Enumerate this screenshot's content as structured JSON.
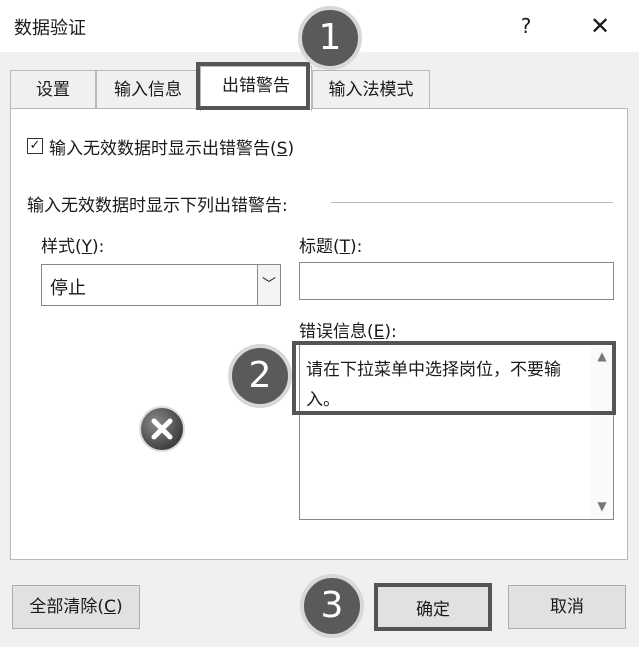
{
  "window": {
    "title": "数据验证",
    "help_label": "?",
    "close_label": "✕"
  },
  "tabs": [
    {
      "label": "设置",
      "active": false
    },
    {
      "label": "输入信息",
      "active": false
    },
    {
      "label": "出错警告",
      "active": true
    },
    {
      "label": "输入法模式",
      "active": false
    }
  ],
  "panel": {
    "show_error_checkbox": {
      "checked": true,
      "check_mark": "☑",
      "label_main": "输入无效数据时显示出错警告(",
      "label_key": "S",
      "label_end": ")"
    },
    "group_label": "输入无效数据时显示下列出错警告:",
    "style": {
      "label_main": "样式(",
      "label_key": "Y",
      "label_end": "):",
      "value": "停止",
      "dropdown_arrow": "﹀"
    },
    "title_field": {
      "label_main": "标题(",
      "label_key": "T",
      "label_end": "):",
      "value": ""
    },
    "error_message": {
      "label_main": "错误信息(",
      "label_key": "E",
      "label_end": "):",
      "value": "请在下拉菜单中选择岗位，不要输入。"
    },
    "stop_icon": "error-stop-icon"
  },
  "callouts": [
    "1",
    "2",
    "3"
  ],
  "buttons": {
    "clear_all_main": "全部清除(",
    "clear_all_key": "C",
    "clear_all_end": ")",
    "ok": "确定",
    "cancel": "取消"
  },
  "colors": {
    "callout_fill": "#5a5a5a",
    "panel_bg": "#ffffff",
    "dialog_bg": "#f0f0f0"
  }
}
